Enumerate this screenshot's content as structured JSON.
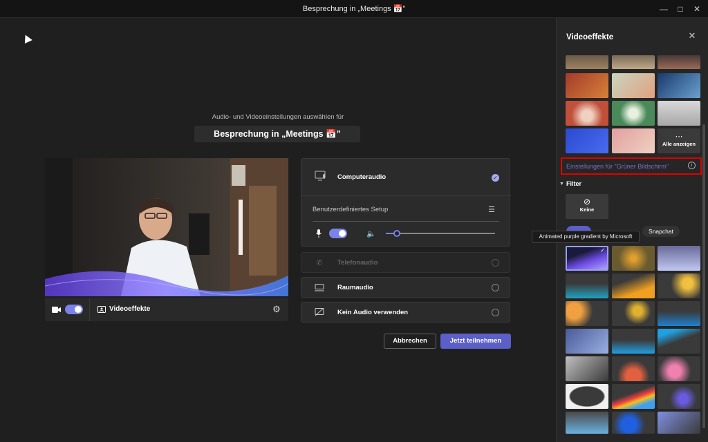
{
  "window": {
    "title": "Besprechung in „Meetings 📅”"
  },
  "main": {
    "subtitle": "Audio- und Videoeinstellungen auswählen für",
    "meeting_name": "Besprechung in „Meetings 📅”",
    "video_effects_label": "Videoeffekte",
    "audio": {
      "computer_audio": "Computeraudio",
      "custom_setup": "Benutzerdefiniertes Setup",
      "phone_audio": "Telefonaudio",
      "room_audio": "Raumaudio",
      "no_audio": "Kein Audio verwenden"
    },
    "cancel": "Abbrechen",
    "join": "Jetzt teilnehmen"
  },
  "sidebar": {
    "title": "Videoeffekte",
    "show_all": "Alle anzeigen",
    "green_screen": "Einstellungen für \"Grüner Bildschirm\"",
    "filter_heading": "Filter",
    "none_label": "Keine",
    "snapchat_label": "Snapchat",
    "tooltip": "Animated purple gradient by Microsoft"
  },
  "colors": {
    "accent": "#5b5fc7",
    "highlight_border": "#e00000",
    "link": "#7b6cc9"
  }
}
